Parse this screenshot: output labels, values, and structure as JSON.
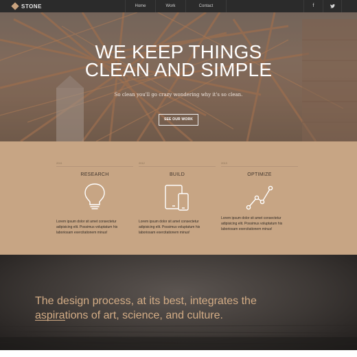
{
  "nav": {
    "brand": "STONE",
    "links": [
      "Home",
      "Work",
      "Contact"
    ],
    "social": [
      "f",
      "t"
    ]
  },
  "hero": {
    "title_line1": "WE KEEP THINGS",
    "title_line2": "CLEAN AND SIMPLE",
    "subtitle": "So clean you'll go crazy wondering why it's so clean.",
    "cta": "SEE OUR WORK"
  },
  "services": [
    {
      "year": "2011",
      "title": "RESEARCH",
      "icon": "lightbulb-icon",
      "text": [
        "Lorem ipsum dolor sit amet consectetur",
        "adipisicing elit. Possimus voluptatum his",
        "laboriosam exercitationem minus!"
      ]
    },
    {
      "year": "2012",
      "title": "BUILD",
      "icon": "devices-icon",
      "text": [
        "Lorem ipsum dolor sit amet consectetur",
        "adipisicing elit. Possimus voluptatum his",
        "laboriosam exercitationem minus!"
      ]
    },
    {
      "year": "2013",
      "title": "OPTIMIZE",
      "icon": "line-chart-icon",
      "text": [
        "Lorem ipsum dolor sit amet consectetur",
        "adipisicing elit. Possimus voluptatum his",
        "laboriosam exercitationem minus!"
      ]
    }
  ],
  "quote": {
    "line1": "The design process, at its best, integrates the",
    "line2": "aspirations of art, science, and culture."
  },
  "colors": {
    "nav_bg": "#2b2b2b",
    "services_bg": "#c7a584",
    "quote_text": "#d4ad86"
  }
}
